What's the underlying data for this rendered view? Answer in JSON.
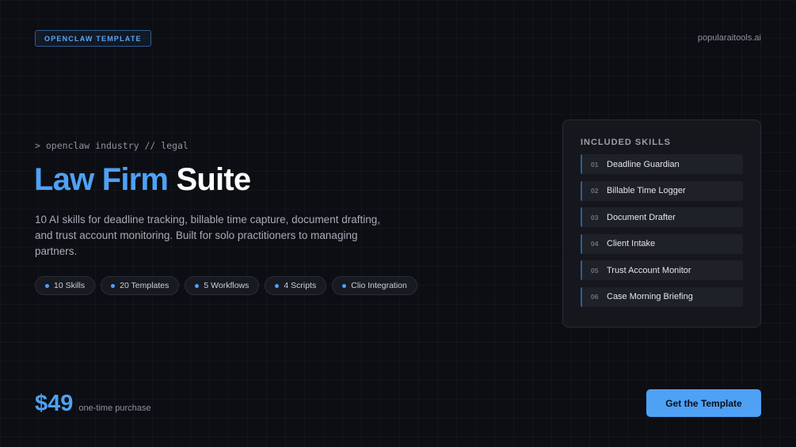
{
  "header": {
    "badge": "OPENCLAW TEMPLATE",
    "site": "popularaitools.ai"
  },
  "hero": {
    "command": "> openclaw industry // legal",
    "title_accent": "Law Firm",
    "title_rest": "Suite",
    "description": "10 AI skills for deadline tracking, billable time capture, document drafting, and trust account monitoring. Built for solo practitioners to managing partners."
  },
  "features": [
    "10 Skills",
    "20 Templates",
    "5 Workflows",
    "4 Scripts",
    "Clio Integration"
  ],
  "skills_panel": {
    "title": "INCLUDED SKILLS",
    "items": [
      {
        "num": "01",
        "name": "Deadline Guardian"
      },
      {
        "num": "02",
        "name": "Billable Time Logger"
      },
      {
        "num": "03",
        "name": "Document Drafter"
      },
      {
        "num": "04",
        "name": "Client Intake"
      },
      {
        "num": "05",
        "name": "Trust Account Monitor"
      },
      {
        "num": "06",
        "name": "Case Morning Briefing"
      }
    ]
  },
  "pricing": {
    "amount": "$49",
    "note": "one-time purchase"
  },
  "cta": {
    "label": "Get the Template"
  },
  "colors": {
    "accent": "#4ea1f5",
    "background": "#0c0e13",
    "panel": "#15171d"
  }
}
